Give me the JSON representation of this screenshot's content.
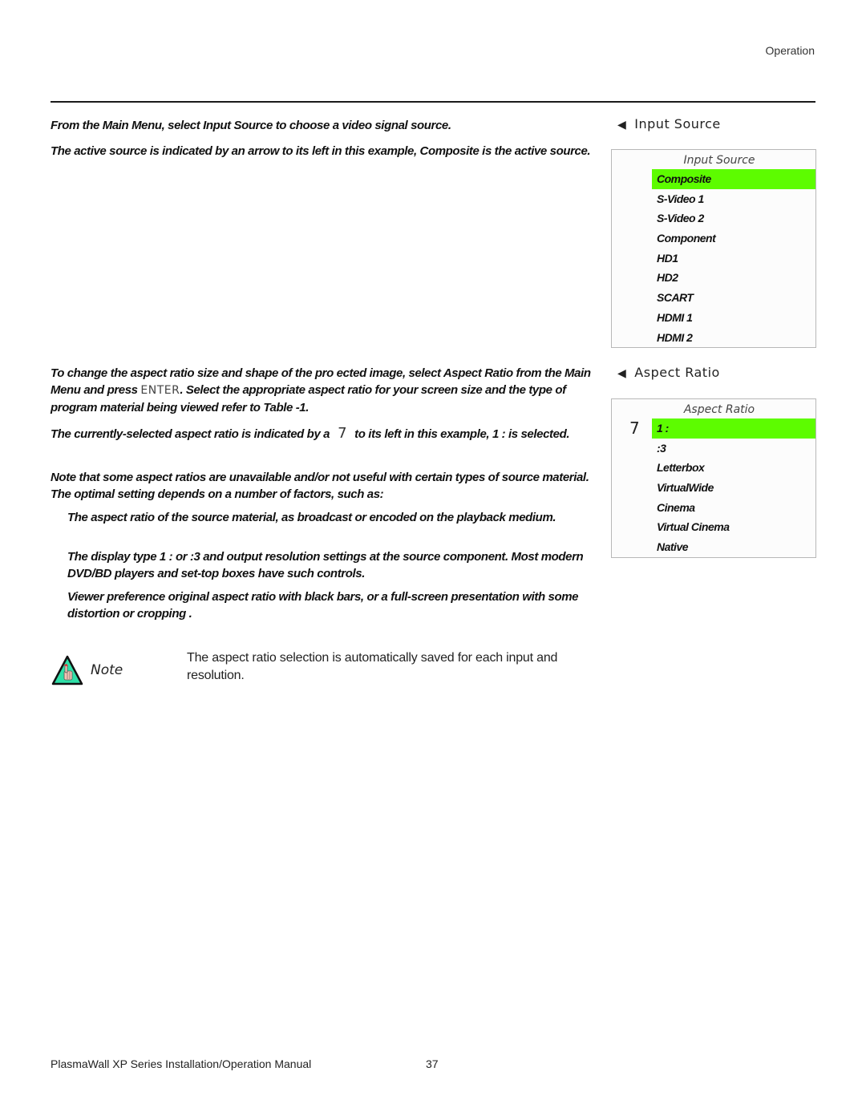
{
  "header": {
    "section": "Operation"
  },
  "paragraphs": {
    "p1": "From the Main Menu, select Input Source to choose a video signal source.",
    "p2": "The active source is indicated by an arrow       to its left  in this example, Composite is the active source.",
    "p3_a": "To change the aspect ratio  size and shape  of the pro ected image, select Aspect Ratio from the Main Menu and press ",
    "p3_key": "ENTER",
    "p3_b": ". Select the appropriate aspect ratio for your screen size and the type of program material being viewed  refer to Table   -1.",
    "p4_a": "The currently-selected aspect ratio is indicated by a",
    "p4_marker": "7",
    "p4_b": "to its left  in this example, 1  :   is selected.",
    "p5": "Note that some aspect ratios are unavailable and/or not useful with certain types of source material. The optimal setting depends on a number of factors, such as:",
    "bullets": [
      "The aspect ratio of the source material, as broadcast or encoded on the playback medium.",
      "The  display type   1  :   or  :3  and output resolution settings at the source component. Most modern DVD/BD players and set-top boxes have such controls.",
      "Viewer preference  original aspect ratio with  black bars,  or a full-screen presentation with some distortion or cropping ."
    ]
  },
  "input_source_menu": {
    "heading_arrow": "◀",
    "heading": "Input Source",
    "title": "Input Source",
    "items": [
      {
        "label": "Composite",
        "selected": true
      },
      {
        "label": "S-Video 1"
      },
      {
        "label": "S-Video 2"
      },
      {
        "label": "Component"
      },
      {
        "label": "HD1"
      },
      {
        "label": "HD2"
      },
      {
        "label": "SCART"
      },
      {
        "label": "HDMI 1"
      },
      {
        "label": "HDMI 2"
      }
    ]
  },
  "aspect_ratio_menu": {
    "heading_arrow": "◀",
    "heading": "Aspect Ratio",
    "title": "Aspect Ratio",
    "marker": "7",
    "items": [
      {
        "label": "1  :",
        "selected": true
      },
      {
        "label": ":3"
      },
      {
        "label": "Letterbox"
      },
      {
        "label": "VirtualWide"
      },
      {
        "label": "Cinema"
      },
      {
        "label": "Virtual Cinema"
      },
      {
        "label": "Native"
      }
    ]
  },
  "note": {
    "icon": "note-hand-icon",
    "label": "Note",
    "text": "The aspect ratio selection is automatically saved for each input and resolution."
  },
  "colors": {
    "highlight": "#5dfc00",
    "note_icon_fill": "#2fe0a8"
  },
  "footer": {
    "title": "PlasmaWall XP Series Installation/Operation Manual",
    "page": "37"
  }
}
